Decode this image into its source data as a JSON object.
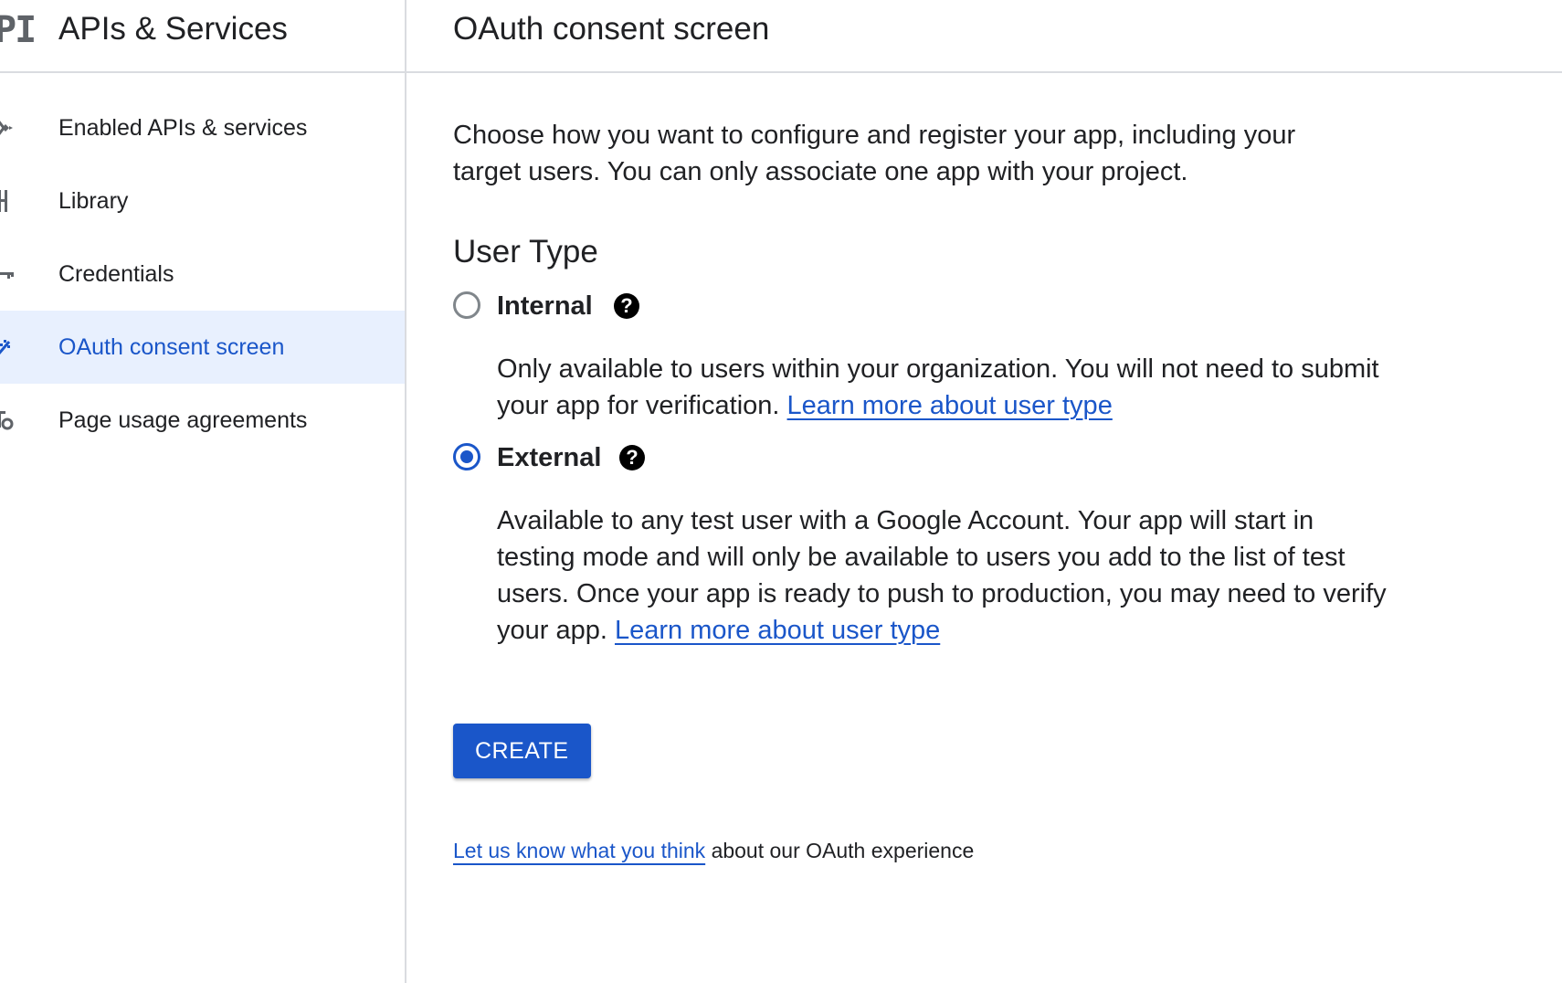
{
  "sidebar": {
    "logo_text": "PI",
    "title": "APIs & Services",
    "items": [
      {
        "label": "Enabled APIs & services",
        "icon": "api-icon",
        "active": false
      },
      {
        "label": "Library",
        "icon": "library-icon",
        "active": false
      },
      {
        "label": "Credentials",
        "icon": "key-icon",
        "active": false
      },
      {
        "label": "OAuth consent screen",
        "icon": "consent-icon",
        "active": true
      },
      {
        "label": "Page usage agreements",
        "icon": "settings-gear-icon",
        "active": false
      }
    ]
  },
  "main": {
    "title": "OAuth consent screen",
    "intro": "Choose how you want to configure and register your app, including your target users. You can only associate one app with your project.",
    "user_type": {
      "heading": "User Type",
      "options": [
        {
          "label": "Internal",
          "selected": false,
          "description": "Only available to users within your organization. You will not need to submit your app for verification.",
          "link": "Learn more about user type"
        },
        {
          "label": "External",
          "selected": true,
          "description": "Available to any test user with a Google Account. Your app will start in testing mode and will only be available to users you add to the list of test users. Once your app is ready to push to production, you may need to verify your app.",
          "link": "Learn more about user type"
        }
      ]
    },
    "create_button": "CREATE",
    "feedback": {
      "link": "Let us know what you think",
      "text": "about our OAuth experience"
    }
  },
  "colors": {
    "accent": "#1a56c9",
    "active_nav_bg": "#e8f0fe",
    "divider": "#dadce0",
    "text": "#202124"
  },
  "help_icon_glyph": "?"
}
